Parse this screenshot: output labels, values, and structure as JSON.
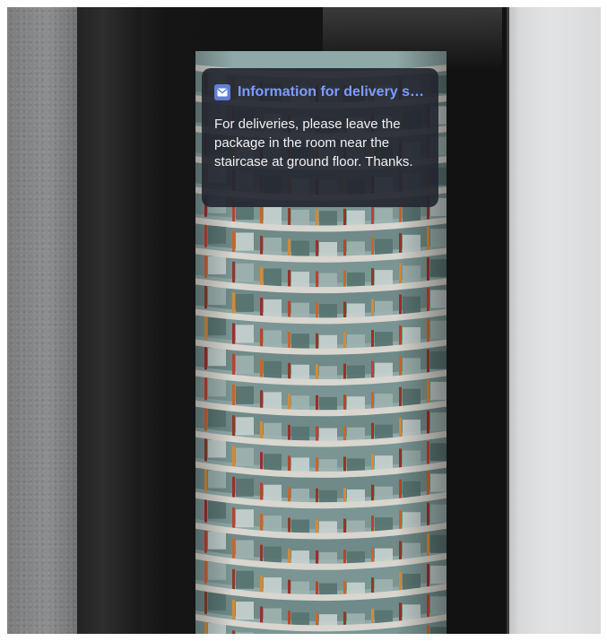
{
  "notification": {
    "app_icon": "mail-icon",
    "title": "Information for delivery servic...",
    "body": "For deliveries, please leave the package in the room near the staircase at ground floor. Thanks.",
    "accent_color": "#7e9cff",
    "icon_color": "#5f7fd8",
    "background_color": "#23263a"
  },
  "display": {
    "background_image": "curved-building-photo"
  }
}
